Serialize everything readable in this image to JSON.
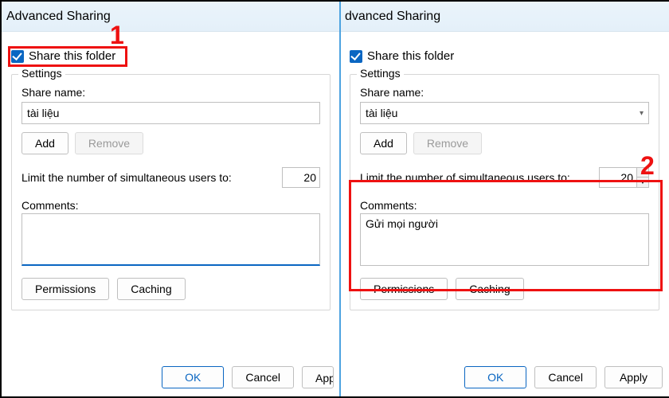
{
  "annotations": {
    "num1": "1",
    "num2": "2"
  },
  "left": {
    "title": "Advanced Sharing",
    "share_label": "Share this folder",
    "group_title": "Settings",
    "share_name_label": "Share name:",
    "share_name_value": "tài liệu",
    "add": "Add",
    "remove": "Remove",
    "limit_label": "Limit the number of simultaneous users to:",
    "limit_value": "20",
    "comments_label": "Comments:",
    "comments_value": "",
    "permissions": "Permissions",
    "caching": "Caching",
    "ok": "OK",
    "cancel": "Cancel",
    "apply": "Apply"
  },
  "right": {
    "title": "dvanced Sharing",
    "share_label": "Share this folder",
    "group_title": "Settings",
    "share_name_label": "Share name:",
    "share_name_value": "tài liệu",
    "add": "Add",
    "remove": "Remove",
    "limit_label": "Limit the number of simultaneous users to:",
    "limit_value": "20",
    "comments_label": "Comments:",
    "comments_value": "Gửi mọi người",
    "permissions": "Permissions",
    "caching": "Caching",
    "ok": "OK",
    "cancel": "Cancel",
    "apply": "Apply"
  }
}
